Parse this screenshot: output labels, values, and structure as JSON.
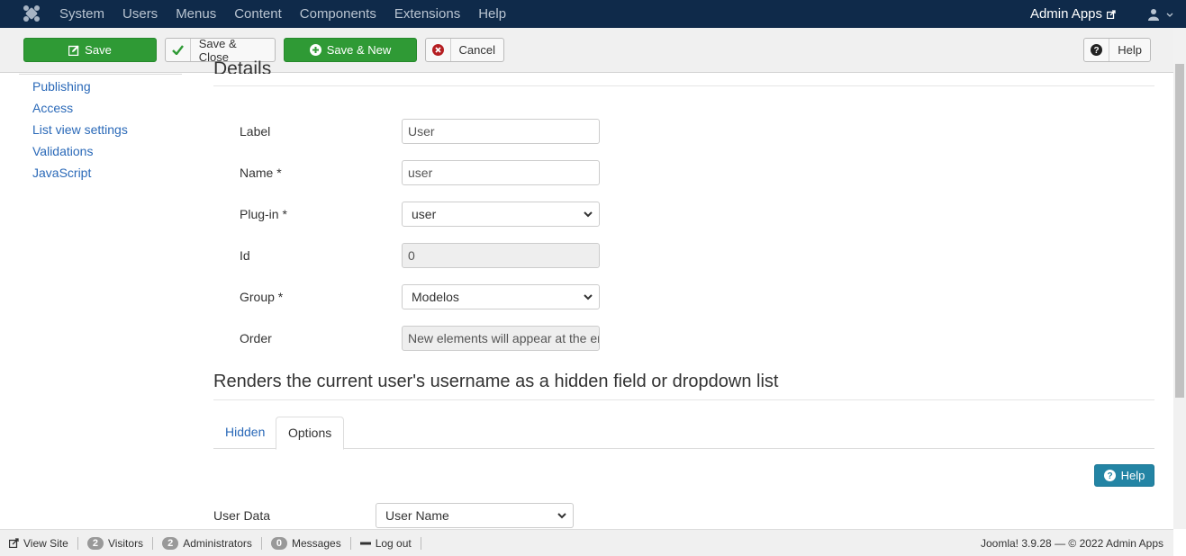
{
  "navbar": {
    "menu": [
      "System",
      "Users",
      "Menus",
      "Content",
      "Components",
      "Extensions",
      "Help"
    ],
    "site_name": "Admin Apps"
  },
  "toolbar": {
    "save": "Save",
    "save_close": "Save & Close",
    "save_new": "Save & New",
    "cancel": "Cancel",
    "help": "Help"
  },
  "sidebar": {
    "items": [
      "Publishing",
      "Access",
      "List view settings",
      "Validations",
      "JavaScript"
    ]
  },
  "details": {
    "legend": "Details",
    "fields": {
      "label": {
        "label": "Label",
        "value": "User"
      },
      "name": {
        "label": "Name *",
        "value": "user"
      },
      "plugin": {
        "label": "Plug-in *",
        "value": "user"
      },
      "id": {
        "label": "Id",
        "value": "0"
      },
      "group": {
        "label": "Group *",
        "value": "Modelos"
      },
      "order": {
        "label": "Order",
        "value": "New elements will appear at the end"
      }
    }
  },
  "plugin_section": {
    "title": "Renders the current user's username as a hidden field or dropdown list",
    "tabs": [
      "Hidden",
      "Options"
    ],
    "active_tab": "Options",
    "help": "Help",
    "user_data": {
      "label": "User Data",
      "value": "User Name"
    }
  },
  "statusbar": {
    "view_site": "View Site",
    "visitors_count": "2",
    "visitors": "Visitors",
    "admins_count": "2",
    "admins": "Administrators",
    "messages_count": "0",
    "messages": "Messages",
    "logout": "Log out",
    "version": "Joomla! 3.9.28",
    "copyright": "© 2022 Admin Apps"
  },
  "colors": {
    "navbar": "#0f2a4a",
    "success": "#2f9a35",
    "info": "#2384a4",
    "link": "#2a69b8"
  }
}
